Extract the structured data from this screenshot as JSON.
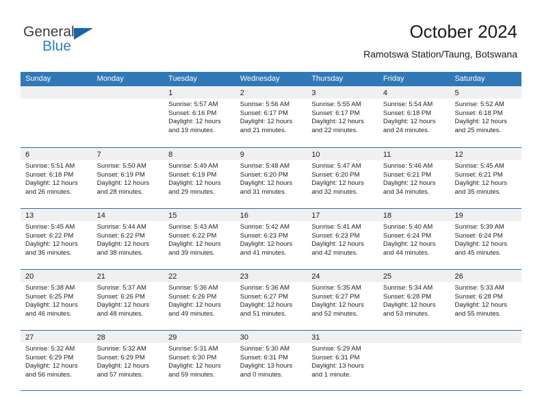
{
  "brand": {
    "name_part1": "General",
    "name_part2": "Blue",
    "triangle_color": "#1565a8",
    "blue_color": "#2a7fc9"
  },
  "header": {
    "title": "October 2024",
    "subtitle": "Ramotswa Station/Taung, Botswana"
  },
  "theme": {
    "header_row_bg": "#3079b8",
    "row_separator": "#2a6ca5",
    "day_band_bg": "#f0f0f0"
  },
  "weekdays": [
    "Sunday",
    "Monday",
    "Tuesday",
    "Wednesday",
    "Thursday",
    "Friday",
    "Saturday"
  ],
  "weeks": [
    [
      {
        "day": "",
        "lines": []
      },
      {
        "day": "",
        "lines": []
      },
      {
        "day": "1",
        "lines": [
          "Sunrise: 5:57 AM",
          "Sunset: 6:16 PM",
          "Daylight: 12 hours",
          "and 19 minutes."
        ]
      },
      {
        "day": "2",
        "lines": [
          "Sunrise: 5:56 AM",
          "Sunset: 6:17 PM",
          "Daylight: 12 hours",
          "and 21 minutes."
        ]
      },
      {
        "day": "3",
        "lines": [
          "Sunrise: 5:55 AM",
          "Sunset: 6:17 PM",
          "Daylight: 12 hours",
          "and 22 minutes."
        ]
      },
      {
        "day": "4",
        "lines": [
          "Sunrise: 5:54 AM",
          "Sunset: 6:18 PM",
          "Daylight: 12 hours",
          "and 24 minutes."
        ]
      },
      {
        "day": "5",
        "lines": [
          "Sunrise: 5:52 AM",
          "Sunset: 6:18 PM",
          "Daylight: 12 hours",
          "and 25 minutes."
        ]
      }
    ],
    [
      {
        "day": "6",
        "lines": [
          "Sunrise: 5:51 AM",
          "Sunset: 6:18 PM",
          "Daylight: 12 hours",
          "and 26 minutes."
        ]
      },
      {
        "day": "7",
        "lines": [
          "Sunrise: 5:50 AM",
          "Sunset: 6:19 PM",
          "Daylight: 12 hours",
          "and 28 minutes."
        ]
      },
      {
        "day": "8",
        "lines": [
          "Sunrise: 5:49 AM",
          "Sunset: 6:19 PM",
          "Daylight: 12 hours",
          "and 29 minutes."
        ]
      },
      {
        "day": "9",
        "lines": [
          "Sunrise: 5:48 AM",
          "Sunset: 6:20 PM",
          "Daylight: 12 hours",
          "and 31 minutes."
        ]
      },
      {
        "day": "10",
        "lines": [
          "Sunrise: 5:47 AM",
          "Sunset: 6:20 PM",
          "Daylight: 12 hours",
          "and 32 minutes."
        ]
      },
      {
        "day": "11",
        "lines": [
          "Sunrise: 5:46 AM",
          "Sunset: 6:21 PM",
          "Daylight: 12 hours",
          "and 34 minutes."
        ]
      },
      {
        "day": "12",
        "lines": [
          "Sunrise: 5:45 AM",
          "Sunset: 6:21 PM",
          "Daylight: 12 hours",
          "and 35 minutes."
        ]
      }
    ],
    [
      {
        "day": "13",
        "lines": [
          "Sunrise: 5:45 AM",
          "Sunset: 6:22 PM",
          "Daylight: 12 hours",
          "and 36 minutes."
        ]
      },
      {
        "day": "14",
        "lines": [
          "Sunrise: 5:44 AM",
          "Sunset: 6:22 PM",
          "Daylight: 12 hours",
          "and 38 minutes."
        ]
      },
      {
        "day": "15",
        "lines": [
          "Sunrise: 5:43 AM",
          "Sunset: 6:22 PM",
          "Daylight: 12 hours",
          "and 39 minutes."
        ]
      },
      {
        "day": "16",
        "lines": [
          "Sunrise: 5:42 AM",
          "Sunset: 6:23 PM",
          "Daylight: 12 hours",
          "and 41 minutes."
        ]
      },
      {
        "day": "17",
        "lines": [
          "Sunrise: 5:41 AM",
          "Sunset: 6:23 PM",
          "Daylight: 12 hours",
          "and 42 minutes."
        ]
      },
      {
        "day": "18",
        "lines": [
          "Sunrise: 5:40 AM",
          "Sunset: 6:24 PM",
          "Daylight: 12 hours",
          "and 44 minutes."
        ]
      },
      {
        "day": "19",
        "lines": [
          "Sunrise: 5:39 AM",
          "Sunset: 6:24 PM",
          "Daylight: 12 hours",
          "and 45 minutes."
        ]
      }
    ],
    [
      {
        "day": "20",
        "lines": [
          "Sunrise: 5:38 AM",
          "Sunset: 6:25 PM",
          "Daylight: 12 hours",
          "and 46 minutes."
        ]
      },
      {
        "day": "21",
        "lines": [
          "Sunrise: 5:37 AM",
          "Sunset: 6:26 PM",
          "Daylight: 12 hours",
          "and 48 minutes."
        ]
      },
      {
        "day": "22",
        "lines": [
          "Sunrise: 5:36 AM",
          "Sunset: 6:26 PM",
          "Daylight: 12 hours",
          "and 49 minutes."
        ]
      },
      {
        "day": "23",
        "lines": [
          "Sunrise: 5:36 AM",
          "Sunset: 6:27 PM",
          "Daylight: 12 hours",
          "and 51 minutes."
        ]
      },
      {
        "day": "24",
        "lines": [
          "Sunrise: 5:35 AM",
          "Sunset: 6:27 PM",
          "Daylight: 12 hours",
          "and 52 minutes."
        ]
      },
      {
        "day": "25",
        "lines": [
          "Sunrise: 5:34 AM",
          "Sunset: 6:28 PM",
          "Daylight: 12 hours",
          "and 53 minutes."
        ]
      },
      {
        "day": "26",
        "lines": [
          "Sunrise: 5:33 AM",
          "Sunset: 6:28 PM",
          "Daylight: 12 hours",
          "and 55 minutes."
        ]
      }
    ],
    [
      {
        "day": "27",
        "lines": [
          "Sunrise: 5:32 AM",
          "Sunset: 6:29 PM",
          "Daylight: 12 hours",
          "and 56 minutes."
        ]
      },
      {
        "day": "28",
        "lines": [
          "Sunrise: 5:32 AM",
          "Sunset: 6:29 PM",
          "Daylight: 12 hours",
          "and 57 minutes."
        ]
      },
      {
        "day": "29",
        "lines": [
          "Sunrise: 5:31 AM",
          "Sunset: 6:30 PM",
          "Daylight: 12 hours",
          "and 59 minutes."
        ]
      },
      {
        "day": "30",
        "lines": [
          "Sunrise: 5:30 AM",
          "Sunset: 6:31 PM",
          "Daylight: 13 hours",
          "and 0 minutes."
        ]
      },
      {
        "day": "31",
        "lines": [
          "Sunrise: 5:29 AM",
          "Sunset: 6:31 PM",
          "Daylight: 13 hours",
          "and 1 minute."
        ]
      },
      {
        "day": "",
        "lines": []
      },
      {
        "day": "",
        "lines": []
      }
    ]
  ]
}
